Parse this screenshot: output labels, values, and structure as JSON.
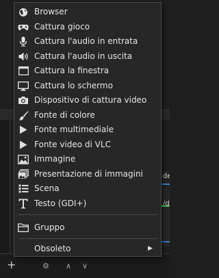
{
  "menu": {
    "items": [
      {
        "label": "Browser",
        "icon": "globe-icon"
      },
      {
        "label": "Cattura gioco",
        "icon": "gamepad-icon"
      },
      {
        "label": "Cattura l'audio in entrata",
        "icon": "microphone-icon"
      },
      {
        "label": "Cattura l'audio in uscita",
        "icon": "speaker-icon"
      },
      {
        "label": "Cattura la finestra",
        "icon": "window-icon"
      },
      {
        "label": "Cattura lo schermo",
        "icon": "monitor-icon"
      },
      {
        "label": "Dispositivo di cattura video",
        "icon": "camera-icon"
      },
      {
        "label": "Fonte di colore",
        "icon": "paintbrush-icon"
      },
      {
        "label": "Fonte multimediale",
        "icon": "play-icon"
      },
      {
        "label": "Fonte video di VLC",
        "icon": "play-icon"
      },
      {
        "label": "Immagine",
        "icon": "image-icon"
      },
      {
        "label": "Presentazione di immagini",
        "icon": "slideshow-icon"
      },
      {
        "label": "Scena",
        "icon": "list-icon"
      },
      {
        "label": "Testo (GDI+)",
        "icon": "text-icon"
      },
      {
        "label": "Gruppo",
        "icon": "folder-icon"
      },
      {
        "label": "Obsoleto",
        "icon": "",
        "submenu_arrow": "▶"
      }
    ]
  },
  "background": {
    "right_texts": [
      "de",
      "/di"
    ],
    "toolbar": {
      "add": "+",
      "remove": "−",
      "settings": "⚙",
      "up": "∧",
      "down": "∨"
    }
  },
  "colors": {
    "menu_bg": "#272727",
    "text": "#e6e6e6",
    "accent_blue": "#2f7fd6",
    "accent_green": "#3bbf5a"
  }
}
